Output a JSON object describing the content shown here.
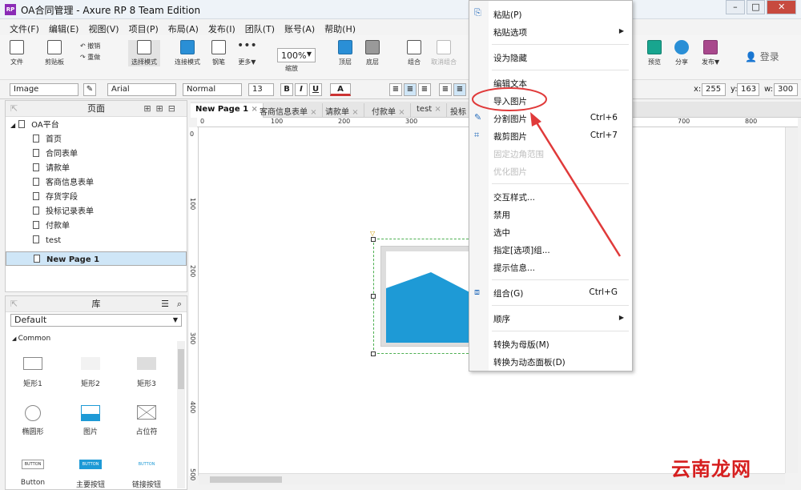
{
  "window": {
    "title": "OA合同管理 - Axure RP 8 Team Edition"
  },
  "menubar": [
    "文件(F)",
    "编辑(E)",
    "视图(V)",
    "项目(P)",
    "布局(A)",
    "发布(I)",
    "团队(T)",
    "账号(A)",
    "帮助(H)"
  ],
  "toolbar": {
    "file": "文件",
    "clipboard": "剪贴板",
    "undo": "撤销",
    "redo": "重做",
    "select_mode": "选择模式",
    "connect": "连接模式",
    "pen": "钢笔",
    "more": "更多▼",
    "zoom_value": "100%",
    "zoom": "缩放",
    "top": "顶层",
    "bottom": "底层",
    "group": "组合",
    "ungroup": "取消组合",
    "preview": "预览",
    "share": "分享",
    "publish": "发布▼",
    "login": "登录"
  },
  "format": {
    "widget_type": "Image",
    "font": "Arial",
    "style": "Normal",
    "size": "13",
    "bold": "B",
    "italic": "I",
    "underline": "U",
    "font_color": "A",
    "x_label": "x:",
    "x": "255",
    "y_label": "y:",
    "y": "163",
    "w_label": "w:",
    "w": "300"
  },
  "pages_panel": {
    "title": "页面",
    "items": [
      {
        "label": "OA平台",
        "level": 0
      },
      {
        "label": "首页",
        "level": 1
      },
      {
        "label": "合同表单",
        "level": 1
      },
      {
        "label": "请款单",
        "level": 1
      },
      {
        "label": "客商信息表单",
        "level": 1
      },
      {
        "label": "存货字段",
        "level": 1
      },
      {
        "label": "投标记录表单",
        "level": 1
      },
      {
        "label": "付款单",
        "level": 1
      },
      {
        "label": "test",
        "level": 1
      },
      {
        "label": "New Page 1",
        "level": 1,
        "selected": true
      }
    ]
  },
  "library_panel": {
    "title": "库",
    "library": "Default",
    "group": "Common",
    "items": [
      "矩形1",
      "矩形2",
      "矩形3",
      "椭圆形",
      "图片",
      "占位符",
      "Button",
      "主要按钮",
      "链接按钮"
    ],
    "button_label": "BUTTON"
  },
  "tabs": [
    "New Page 1",
    "客商信息表单",
    "请款单",
    "付款单",
    "test",
    "投标"
  ],
  "ruler": {
    "h": [
      "0",
      "100",
      "200",
      "300",
      "700",
      "800"
    ],
    "v": [
      "0",
      "100",
      "200",
      "300",
      "400",
      "500"
    ]
  },
  "context_menu": {
    "items": [
      {
        "label": "粘贴(P)",
        "icon": "paste-icon"
      },
      {
        "label": "粘贴选项",
        "submenu": true
      },
      {
        "label": "设为隐藏"
      },
      {
        "label": "编辑文本"
      },
      {
        "label": "导入图片",
        "highlighted": true
      },
      {
        "label": "分割图片",
        "shortcut": "Ctrl+6",
        "icon": "slice-icon"
      },
      {
        "label": "裁剪图片",
        "shortcut": "Ctrl+7",
        "icon": "crop-icon"
      },
      {
        "label": "固定边角范围",
        "disabled": true
      },
      {
        "label": "优化图片",
        "disabled": true
      },
      {
        "label": "交互样式..."
      },
      {
        "label": "禁用"
      },
      {
        "label": "选中"
      },
      {
        "label": "指定[选项]组..."
      },
      {
        "label": "提示信息..."
      },
      {
        "label": "组合(G)",
        "shortcut": "Ctrl+G",
        "icon": "group-icon"
      },
      {
        "label": "顺序",
        "submenu": true
      },
      {
        "label": "转换为母版(M)"
      },
      {
        "label": "转换为动态面板(D)"
      }
    ]
  },
  "colors": {
    "annotation": "#e03a3a",
    "image_fill": "#1e9ad6",
    "selection": "#4caf50"
  },
  "watermark": "云南龙网"
}
